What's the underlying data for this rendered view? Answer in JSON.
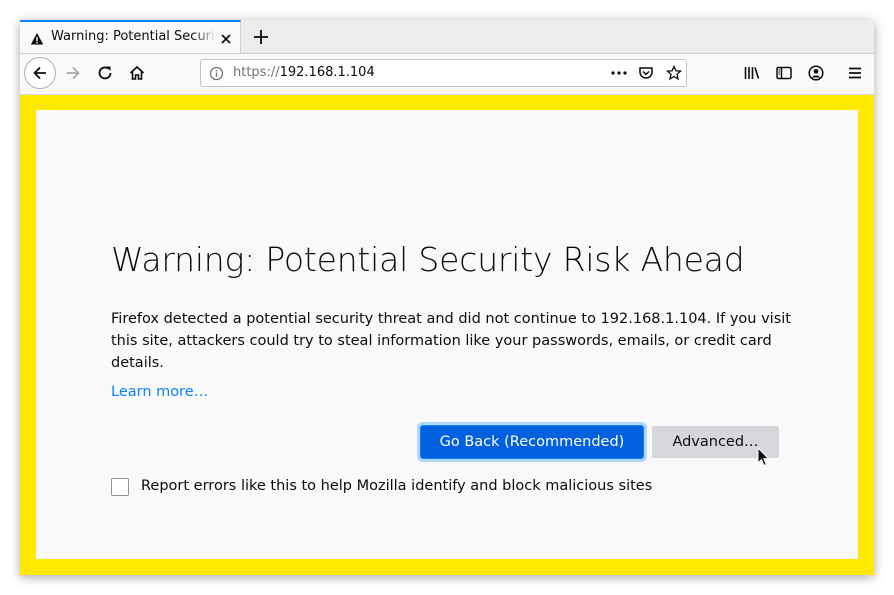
{
  "tab": {
    "title": "Warning: Potential Security Risk Ahead",
    "icon": "warning-icon"
  },
  "navbar": {
    "url_scheme": "https://",
    "url_host": "192.168.1.104",
    "icons": [
      "back-icon",
      "forward-icon",
      "reload-icon",
      "home-icon",
      "info-icon",
      "page-actions-icon",
      "pocket-icon",
      "bookmark-star-icon",
      "library-icon",
      "sidebar-icon",
      "account-icon",
      "menu-icon"
    ]
  },
  "page": {
    "title": "Warning: Potential Security Risk Ahead",
    "description": "Firefox detected a potential security threat and did not continue to 192.168.1.104. If you visit this site, attackers could try to steal information like your passwords, emails, or credit card details.",
    "learn_more": "Learn more…",
    "go_back_label": "Go Back (Recommended)",
    "advanced_label": "Advanced…",
    "report_label": "Report errors like this to help Mozilla identify and block malicious sites",
    "report_checked": false
  },
  "colors": {
    "warning_frame": "#ffe900",
    "primary_button": "#0060df",
    "link": "#0a84ff",
    "page_background": "#f9f9fa"
  }
}
